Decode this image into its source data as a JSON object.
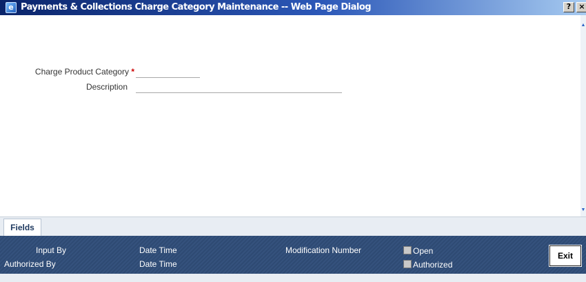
{
  "window": {
    "title": "Payments & Collections Charge Category Maintenance -- Web Page Dialog",
    "help_label": "?",
    "close_label": "×",
    "icon_name": "ie-page-icon"
  },
  "form": {
    "charge_product_category": {
      "label": "Charge Product Category",
      "required_mark": "*",
      "value": ""
    },
    "description": {
      "label": "Description",
      "value": ""
    }
  },
  "tabs": [
    {
      "label": "Fields",
      "active": true
    }
  ],
  "audit": {
    "input_by_label": "Input By",
    "authorized_by_label": "Authorized By",
    "date_time_label_1": "Date Time",
    "date_time_label_2": "Date Time",
    "modification_number_label": "Modification Number",
    "open_label": "Open",
    "authorized_label": "Authorized",
    "exit_label": "Exit"
  },
  "colors": {
    "title_bar_start": "#0a246a",
    "title_bar_end": "#a6caf0",
    "audit_background": "#2e4a73",
    "required_mark": "#cc0000"
  }
}
